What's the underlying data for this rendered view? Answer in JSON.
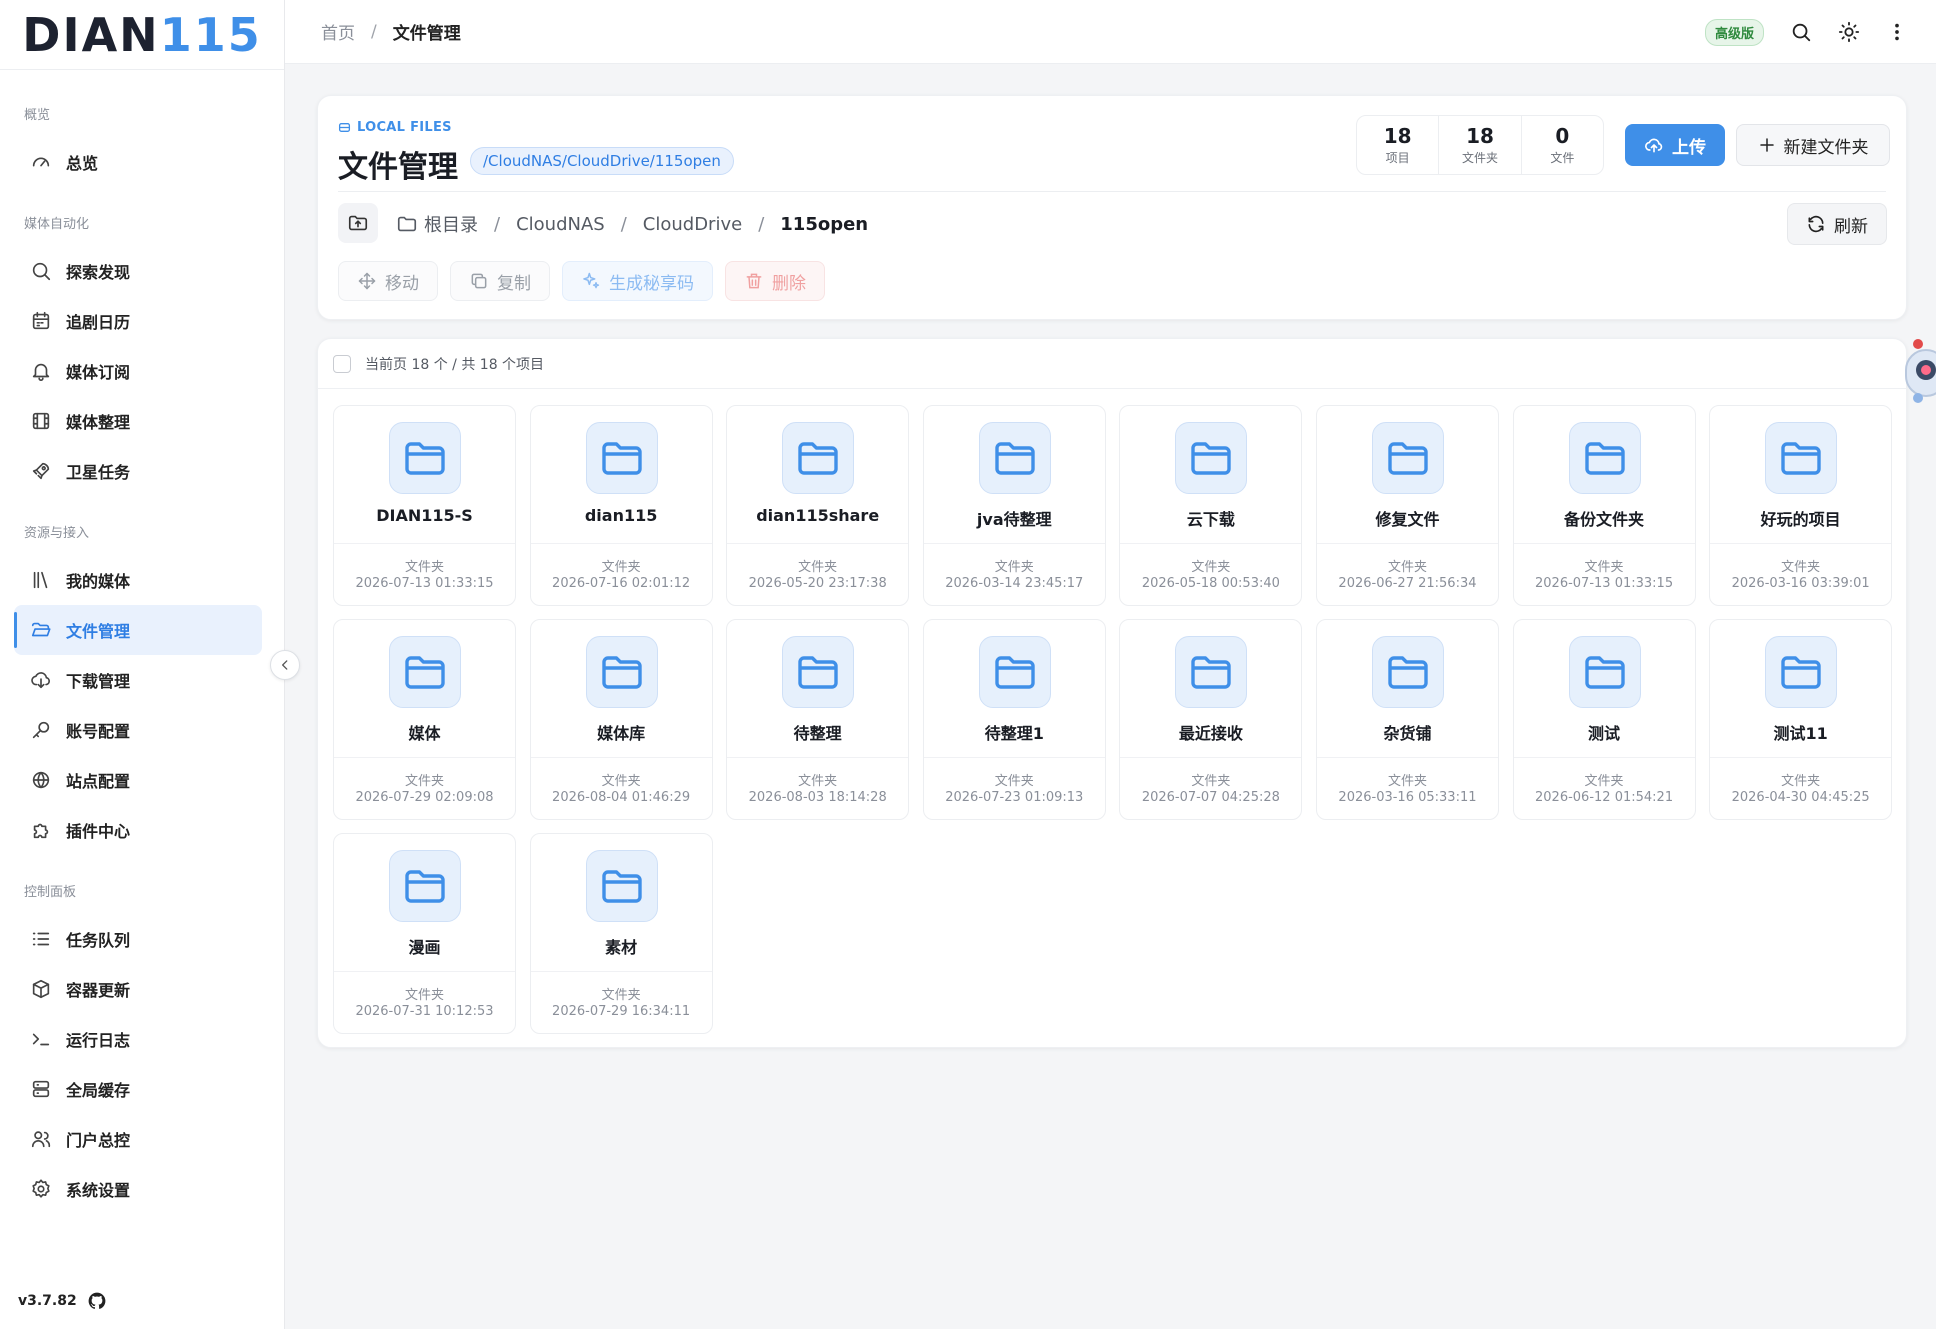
{
  "sidebar": {
    "logo_a": "DIAN",
    "logo_b": "115",
    "groups": [
      {
        "label": "概览",
        "items": [
          {
            "label": "总览",
            "icon": "gauge-icon"
          }
        ]
      },
      {
        "label": "媒体自动化",
        "items": [
          {
            "label": "探索发现",
            "icon": "search-icon"
          },
          {
            "label": "追剧日历",
            "icon": "calendar-icon"
          },
          {
            "label": "媒体订阅",
            "icon": "bell-icon"
          },
          {
            "label": "媒体整理",
            "icon": "film-icon"
          },
          {
            "label": "卫星任务",
            "icon": "rocket-icon"
          }
        ]
      },
      {
        "label": "资源与接入",
        "items": [
          {
            "label": "我的媒体",
            "icon": "library-icon"
          },
          {
            "label": "文件管理",
            "icon": "folder-open-icon",
            "active": true
          },
          {
            "label": "下载管理",
            "icon": "cloud-download-icon"
          },
          {
            "label": "账号配置",
            "icon": "key-icon"
          },
          {
            "label": "站点配置",
            "icon": "globe-icon"
          },
          {
            "label": "插件中心",
            "icon": "puzzle-icon"
          }
        ]
      },
      {
        "label": "控制面板",
        "items": [
          {
            "label": "任务队列",
            "icon": "list-icon"
          },
          {
            "label": "容器更新",
            "icon": "box-icon"
          },
          {
            "label": "运行日志",
            "icon": "terminal-icon"
          },
          {
            "label": "全局缓存",
            "icon": "server-icon"
          },
          {
            "label": "门户总控",
            "icon": "users-icon"
          },
          {
            "label": "系统设置",
            "icon": "gear-icon"
          }
        ]
      }
    ],
    "version": "v3.7.82"
  },
  "topbar": {
    "breadcrumb_home": "首页",
    "breadcrumb_sep": "/",
    "breadcrumb_current": "文件管理",
    "badge": "高级版"
  },
  "header": {
    "section_label": "LOCAL FILES",
    "title": "文件管理",
    "path_chip": "/CloudNAS/CloudDrive/115open",
    "stats": [
      {
        "value": "18",
        "label": "项目"
      },
      {
        "value": "18",
        "label": "文件夹"
      },
      {
        "value": "0",
        "label": "文件"
      }
    ],
    "upload_label": "上传",
    "new_folder_label": "新建文件夹",
    "path": [
      "根目录",
      "CloudNAS",
      "CloudDrive",
      "115open"
    ],
    "path_sep": "/",
    "refresh_label": "刷新",
    "actions": {
      "move": "移动",
      "copy": "复制",
      "share": "生成秘享码",
      "delete": "删除"
    }
  },
  "list": {
    "summary": "当前页 18 个 / 共 18 个项目",
    "items": [
      {
        "name": "DIAN115-S",
        "type": "文件夹",
        "date": "2026-07-13 01:33:15"
      },
      {
        "name": "dian115",
        "type": "文件夹",
        "date": "2026-07-16 02:01:12"
      },
      {
        "name": "dian115share",
        "type": "文件夹",
        "date": "2026-05-20 23:17:38"
      },
      {
        "name": "jva待整理",
        "type": "文件夹",
        "date": "2026-03-14 23:45:17"
      },
      {
        "name": "云下载",
        "type": "文件夹",
        "date": "2026-05-18 00:53:40"
      },
      {
        "name": "修复文件",
        "type": "文件夹",
        "date": "2026-06-27 21:56:34"
      },
      {
        "name": "备份文件夹",
        "type": "文件夹",
        "date": "2026-07-13 01:33:15"
      },
      {
        "name": "好玩的项目",
        "type": "文件夹",
        "date": "2026-03-16 03:39:01"
      },
      {
        "name": "媒体",
        "type": "文件夹",
        "date": "2026-07-29 02:09:08"
      },
      {
        "name": "媒体库",
        "type": "文件夹",
        "date": "2026-08-04 01:46:29"
      },
      {
        "name": "待整理",
        "type": "文件夹",
        "date": "2026-08-03 18:14:28"
      },
      {
        "name": "待整理1",
        "type": "文件夹",
        "date": "2026-07-23 01:09:13"
      },
      {
        "name": "最近接收",
        "type": "文件夹",
        "date": "2026-07-07 04:25:28"
      },
      {
        "name": "杂货铺",
        "type": "文件夹",
        "date": "2026-03-16 05:33:11"
      },
      {
        "name": "测试",
        "type": "文件夹",
        "date": "2026-06-12 01:54:21"
      },
      {
        "name": "测试11",
        "type": "文件夹",
        "date": "2026-04-30 04:45:25"
      },
      {
        "name": "漫画",
        "type": "文件夹",
        "date": "2026-07-31 10:12:53"
      },
      {
        "name": "素材",
        "type": "文件夹",
        "date": "2026-07-29 16:34:11"
      }
    ]
  },
  "colors": {
    "accent": "#3f8fe8",
    "active_bg": "#e9f1fd",
    "folder_bg": "#e6f0fc"
  }
}
